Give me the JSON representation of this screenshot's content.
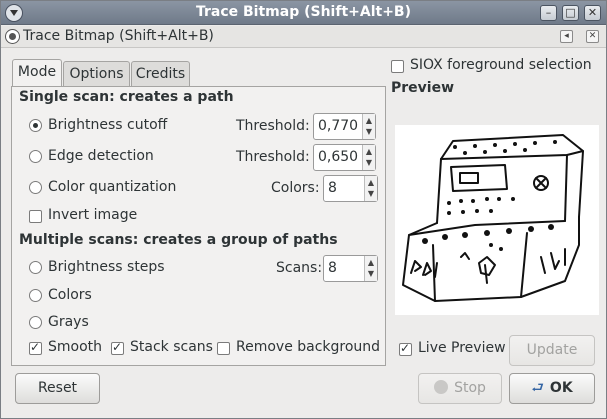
{
  "window": {
    "title": "Trace Bitmap (Shift+Alt+B)"
  },
  "dock": {
    "title": "Trace Bitmap (Shift+Alt+B)"
  },
  "tabs": [
    {
      "label": "Mode"
    },
    {
      "label": "Options"
    },
    {
      "label": "Credits"
    }
  ],
  "single_scan": {
    "heading": "Single scan: creates a path",
    "brightness": {
      "label": "Brightness cutoff",
      "selected": true,
      "param_label": "Threshold:",
      "value": "0,770"
    },
    "edge": {
      "label": "Edge detection",
      "selected": false,
      "param_label": "Threshold:",
      "value": "0,650"
    },
    "color": {
      "label": "Color quantization",
      "selected": false,
      "param_label": "Colors:",
      "value": "8"
    },
    "invert": {
      "label": "Invert image",
      "checked": false
    }
  },
  "multiple_scans": {
    "heading": "Multiple scans: creates a group of paths",
    "brightness_steps": {
      "label": "Brightness steps",
      "selected": false,
      "param_label": "Scans:",
      "value": "8"
    },
    "colors": {
      "label": "Colors",
      "selected": false
    },
    "grays": {
      "label": "Grays",
      "selected": false
    },
    "smooth": {
      "label": "Smooth",
      "checked": true
    },
    "stack": {
      "label": "Stack scans",
      "checked": true
    },
    "remove_bg": {
      "label": "Remove background",
      "checked": false
    }
  },
  "siox": {
    "label": "SIOX foreground selection",
    "checked": false
  },
  "preview": {
    "heading": "Preview",
    "live_label": "Live Preview",
    "live_checked": true,
    "update_label": "Update"
  },
  "buttons": {
    "reset": "Reset",
    "stop": "Stop",
    "ok": "OK"
  },
  "icons": {
    "window_menu": "window-menu-icon",
    "minimize": "minimize-icon",
    "maximize": "maximize-icon",
    "close": "close-icon",
    "stop": "stop-icon",
    "ok": "ok-arrow-icon"
  }
}
